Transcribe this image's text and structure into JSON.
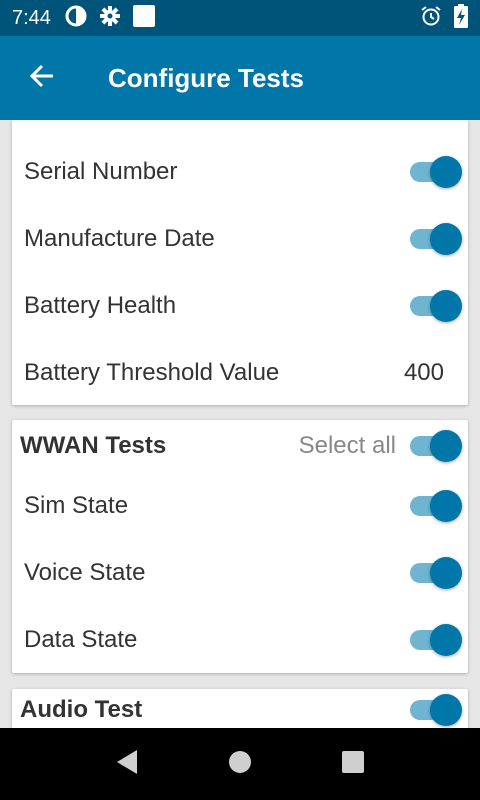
{
  "status_bar": {
    "time": "7:44",
    "icons_left": [
      "data-saver-icon",
      "gear-icon",
      "square-notification-icon"
    ],
    "icons_right": [
      "alarm-icon",
      "battery-charging-icon"
    ]
  },
  "app_bar": {
    "title": "Configure Tests",
    "back_icon": "arrow-back-icon"
  },
  "colors": {
    "accent": "#0077a8",
    "status_bar": "#00547a",
    "switch_track": "#6fb5d2"
  },
  "battery_card": {
    "rows": [
      {
        "label": "Serial Number",
        "toggle": true
      },
      {
        "label": "Manufacture Date",
        "toggle": true
      },
      {
        "label": "Battery Health",
        "toggle": true
      },
      {
        "label": "Battery Threshold Value",
        "value": "400"
      }
    ]
  },
  "wwan_card": {
    "title": "WWAN Tests",
    "select_all_label": "Select all",
    "select_all_toggle": true,
    "rows": [
      {
        "label": "Sim State",
        "toggle": true
      },
      {
        "label": "Voice State",
        "toggle": true
      },
      {
        "label": "Data State",
        "toggle": true
      }
    ]
  },
  "audio_card": {
    "title": "Audio Test",
    "toggle": true
  },
  "nav_bar": {
    "buttons": [
      "back-triangle-icon",
      "home-circle-icon",
      "recents-square-icon"
    ]
  }
}
